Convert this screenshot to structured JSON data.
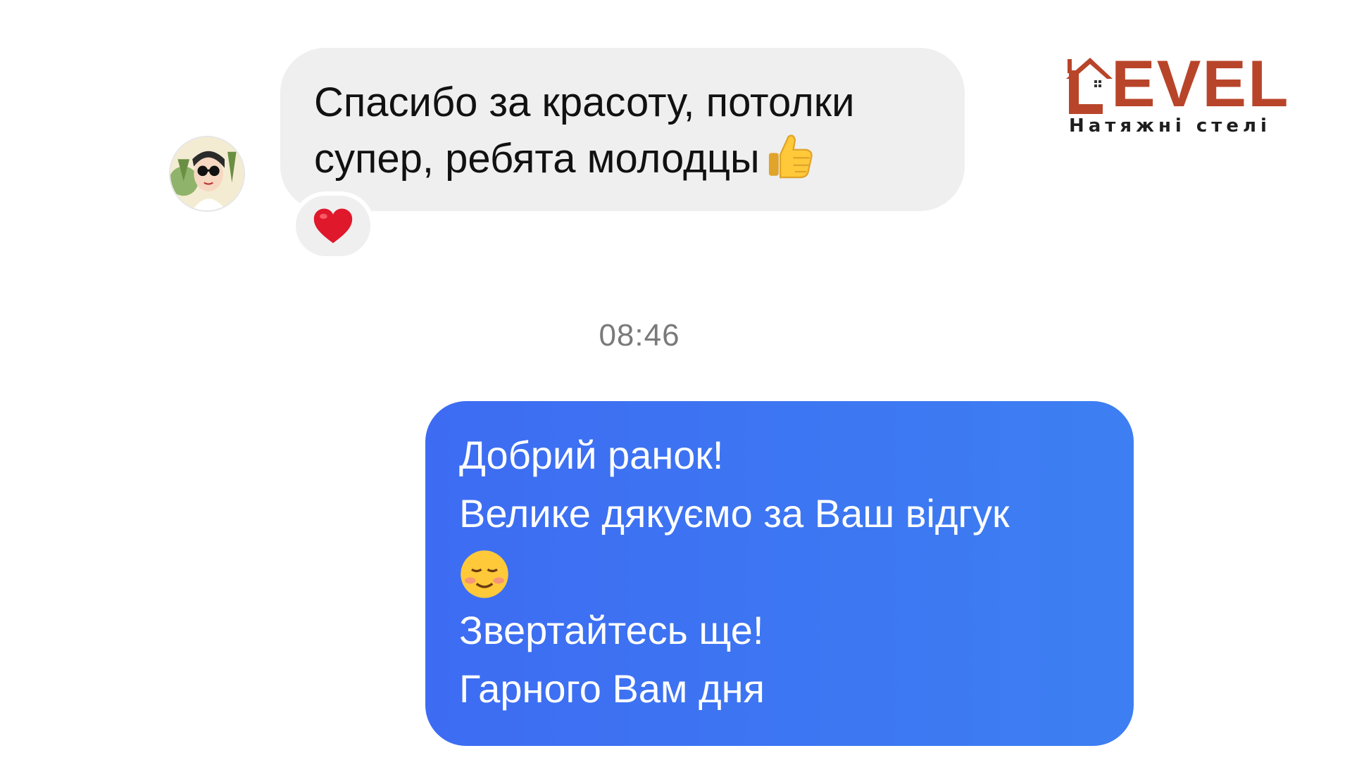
{
  "incoming_message": {
    "lines": [
      "Спасибо за красоту, потолки",
      "супер, ребята молодцы"
    ],
    "trailing_emoji": "thumbs-up",
    "reaction_emoji": "red-heart"
  },
  "timestamp": "08:46",
  "outgoing_message": {
    "lines": [
      "Добрий ранок!",
      "Велике дякуємо за Ваш відгук",
      "Звертайтесь ще!",
      "Гарного Вам дня"
    ],
    "inline_emoji": "smiling-face"
  },
  "logo": {
    "wordmark": "EVEL",
    "tagline": "Натяжні стелі"
  },
  "colors": {
    "incoming_bubble": "#efefef",
    "outgoing_bubble": "#3d6cf2",
    "brand": "#b8452a",
    "timestamp": "#7a7a7a"
  }
}
